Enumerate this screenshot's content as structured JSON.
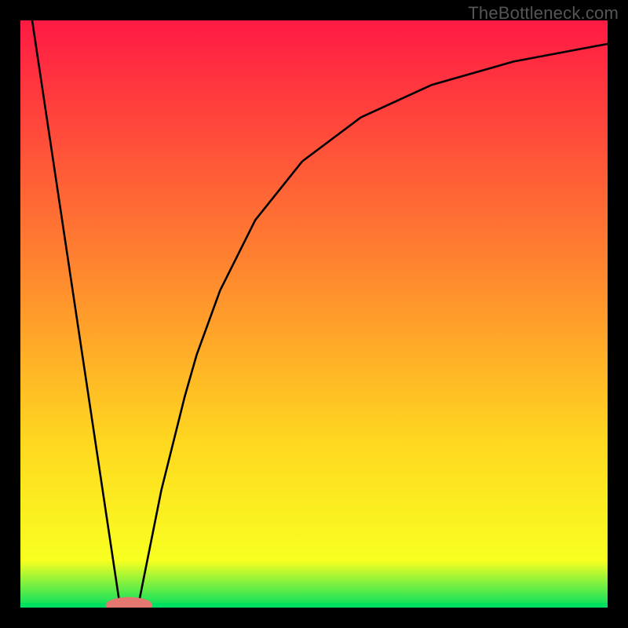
{
  "watermark": "TheBottleneck.com",
  "chart_data": {
    "type": "line",
    "title": "",
    "xlabel": "",
    "ylabel": "",
    "xlim": [
      0,
      100
    ],
    "ylim": [
      0,
      100
    ],
    "grid": false,
    "legend": false,
    "background_gradient": [
      "#ff1a44",
      "#ff8030",
      "#ffd820",
      "#f8ff20",
      "#00e060"
    ],
    "series": [
      {
        "name": "left-branch",
        "x": [
          2,
          17
        ],
        "y": [
          100,
          0
        ]
      },
      {
        "name": "right-branch",
        "x": [
          20,
          22,
          24,
          26,
          28,
          30,
          34,
          40,
          48,
          58,
          70,
          84,
          100
        ],
        "y": [
          0,
          10,
          20,
          28,
          36,
          43,
          54,
          66,
          76,
          83.5,
          89,
          93,
          96
        ]
      }
    ],
    "marker": {
      "name": "minimum-marker",
      "x": 18.5,
      "y": 0,
      "rx": 4,
      "ry": 1.4,
      "color": "#e4776f"
    },
    "baseline": {
      "y": 0,
      "color": "#00e060"
    }
  }
}
